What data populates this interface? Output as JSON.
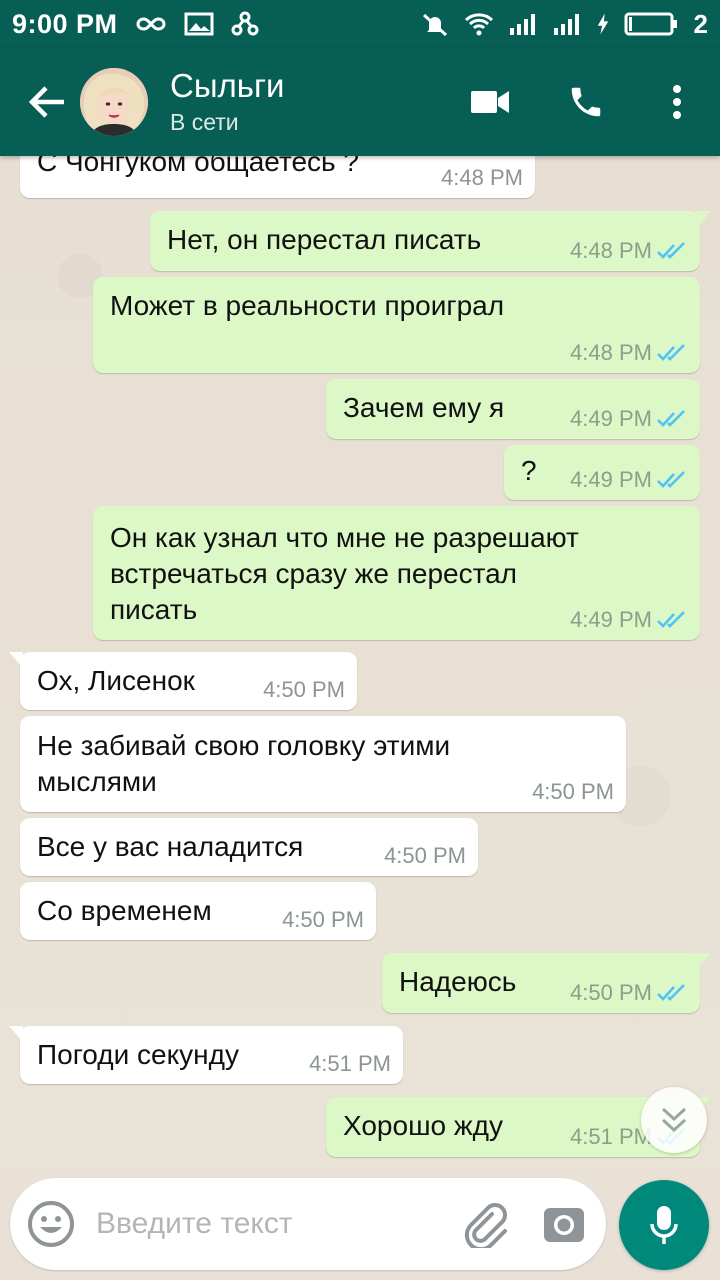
{
  "status_bar": {
    "time": "9:00 PM",
    "battery_level": "2"
  },
  "header": {
    "contact_name": "Сыльги",
    "contact_status": "В сети"
  },
  "messages": [
    {
      "dir": "in",
      "text": "С Чонгуком общаетесь ?",
      "time": "4:48 PM"
    },
    {
      "dir": "out",
      "text": "Нет, он перестал писать",
      "time": "4:48 PM",
      "status": "read"
    },
    {
      "dir": "out",
      "text": "Может в реальности проиграл",
      "time": "4:48 PM",
      "status": "read"
    },
    {
      "dir": "out",
      "text": "Зачем ему я",
      "time": "4:49 PM",
      "status": "read"
    },
    {
      "dir": "out",
      "text": "?",
      "time": "4:49 PM",
      "status": "read"
    },
    {
      "dir": "out",
      "text_lines": [
        "Он как узнал что мне не разрешают",
        "встречаться сразу же перестал",
        "писать"
      ],
      "time": "4:49 PM",
      "status": "read"
    },
    {
      "dir": "in",
      "text": "Ох, Лисенок",
      "time": "4:50 PM"
    },
    {
      "dir": "in",
      "text_lines": [
        "Не забивай  свою головку этими",
        "мыслями"
      ],
      "time": "4:50 PM"
    },
    {
      "dir": "in",
      "text": "Все у вас наладится",
      "time": "4:50 PM"
    },
    {
      "dir": "in",
      "text": "Со временем",
      "time": "4:50 PM"
    },
    {
      "dir": "out",
      "text": "Надеюсь",
      "time": "4:50 PM",
      "status": "read"
    },
    {
      "dir": "in",
      "text": "Погоди секунду",
      "time": "4:51 PM"
    },
    {
      "dir": "out",
      "text": "Хорошо жду",
      "time": "4:51 PM",
      "status": "read"
    }
  ],
  "composer": {
    "placeholder": "Введите текст"
  },
  "colors": {
    "header": "#075e54",
    "outgoing_bubble": "#dcf8c6",
    "incoming_bubble": "#ffffff",
    "read_ticks": "#4fc3f7",
    "mic_button": "#00897b"
  }
}
